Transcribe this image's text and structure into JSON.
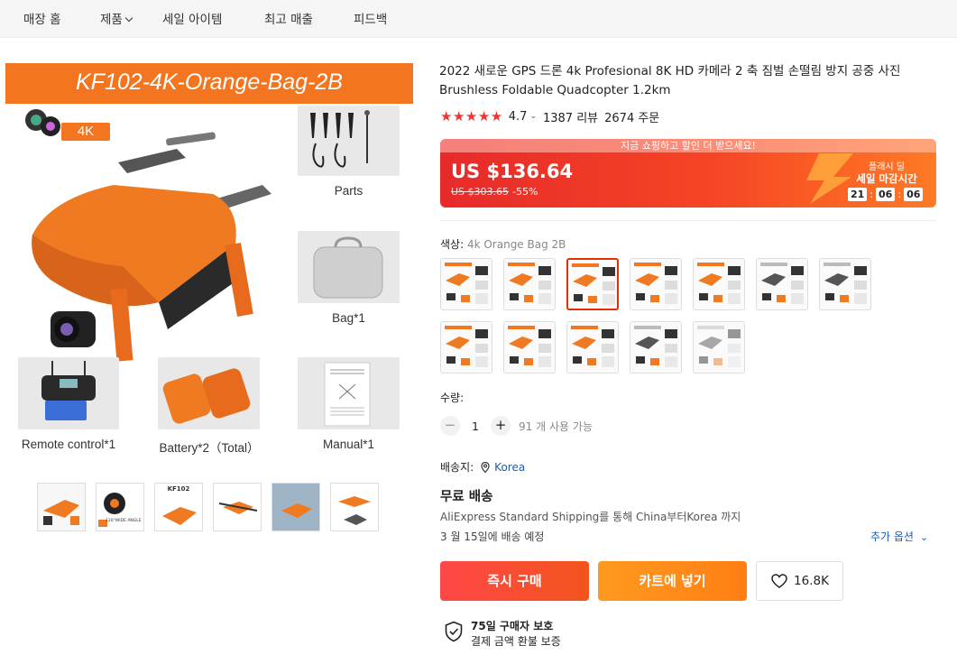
{
  "nav": {
    "items": [
      "매장 홈",
      "제품",
      "세일 아이템",
      "최고 매출",
      "피드백"
    ]
  },
  "gallery": {
    "banner_text": "KF102-4K-Orange-Bag-2B",
    "badge": "4K",
    "labels": {
      "parts": "Parts",
      "bag": "Bag*1",
      "remote": "Remote control*1",
      "battery": "Battery*2（Total）",
      "manual": "Manual*1"
    },
    "thumbnail_count": 6,
    "thumb_texts": [
      "KF102",
      "120°WIDE ANGLE"
    ]
  },
  "product": {
    "title": "2022 새로운 GPS 드론 4k Profesional 8K HD 카메라 2 축 짐벌 손떨림 방지 공중 사진 Brushless Foldable Quadcopter 1.2km",
    "rating": "4.7",
    "reviews": "1387 리뷰",
    "orders": "2674 주문"
  },
  "promo": {
    "banner": "지금 쇼핑하고 할인 더 받으세요!",
    "price": "US $136.64",
    "old_price": "US $303.65",
    "discount": "-55%",
    "flash_title": "플래시 딜",
    "flash_sub": "세일 마감시간",
    "countdown": [
      "21",
      "06",
      "06"
    ]
  },
  "variant": {
    "label": "색상:",
    "selected": "4k Orange Bag 2B",
    "selected_index": 2,
    "swatch_count": 12
  },
  "quantity": {
    "label": "수량:",
    "minus": "−",
    "plus": "+",
    "value": "1",
    "available": "91 개 사용 가능"
  },
  "shipping": {
    "label": "배송지:",
    "location": "Korea",
    "free": "무료 배송",
    "method": "AliExpress Standard Shipping를 통해 China부터Korea 까지",
    "delivery": "3 월 15일에 배송 예정",
    "more_options": "추가 옵션"
  },
  "actions": {
    "buy_now": "즉시 구매",
    "add_to_cart": "카트에 넣기",
    "wishlist_count": "16.8K"
  },
  "protection": {
    "title": "75일 구매자 보호",
    "subtitle": "결제 금액 환불 보증"
  },
  "colors": {
    "accent": "#e62e04",
    "drone_orange": "#f4751f",
    "link": "#1a5fb4",
    "star": "#ee3434"
  }
}
